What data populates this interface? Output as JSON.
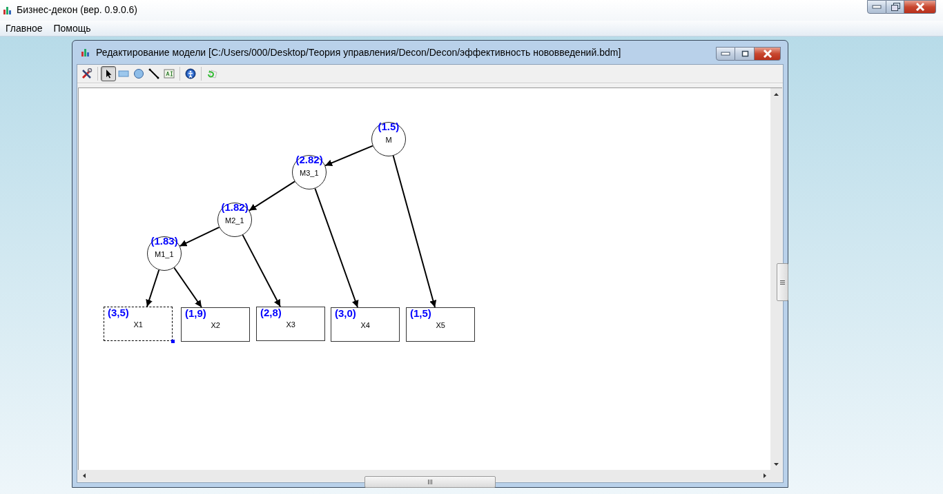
{
  "window": {
    "title": "Бизнес-декон (вер. 0.9.0.6)"
  },
  "menu": [
    "Главное",
    "Помощь"
  ],
  "model_window": {
    "title": "Редактирование модели [C:/Users/000/Desktop/Теория управления/Decon/Decon/эффективность нововведений.bdm]",
    "toolbar": [
      {
        "kind": "tools",
        "selected": false
      },
      {
        "kind": "separator"
      },
      {
        "kind": "pointer",
        "selected": true
      },
      {
        "kind": "rectangle",
        "selected": false
      },
      {
        "kind": "ellipse",
        "selected": false
      },
      {
        "kind": "line",
        "selected": false
      },
      {
        "kind": "text",
        "selected": false
      },
      {
        "kind": "separator"
      },
      {
        "kind": "help",
        "selected": false
      },
      {
        "kind": "separator"
      },
      {
        "kind": "refresh",
        "selected": false
      }
    ],
    "diagram": {
      "kind": "circle",
      "value": "(1.5)",
      "name": "M",
      "selected": false,
      "children": [
        {
          "kind": "circle",
          "value": "(2.82)",
          "name": "M3_1",
          "selected": false,
          "children": [
            {
              "kind": "circle",
              "value": "(1.82)",
              "name": "M2_1",
              "selected": false,
              "children": [
                {
                  "kind": "circle",
                  "value": "(1.83)",
                  "name": "M1_1",
                  "selected": false,
                  "children": [
                    {
                      "kind": "box",
                      "value": "(3,5)",
                      "name": "X1",
                      "selected": true
                    },
                    {
                      "kind": "box",
                      "value": "(1,9)",
                      "name": "X2",
                      "selected": false
                    }
                  ]
                },
                {
                  "kind": "box",
                  "value": "(2,8)",
                  "name": "X3",
                  "selected": false
                }
              ]
            },
            {
              "kind": "box",
              "value": "(3,0)",
              "name": "X4",
              "selected": false
            }
          ]
        },
        {
          "kind": "box",
          "value": "(1,5)",
          "name": "X5",
          "selected": false
        }
      ]
    }
  }
}
